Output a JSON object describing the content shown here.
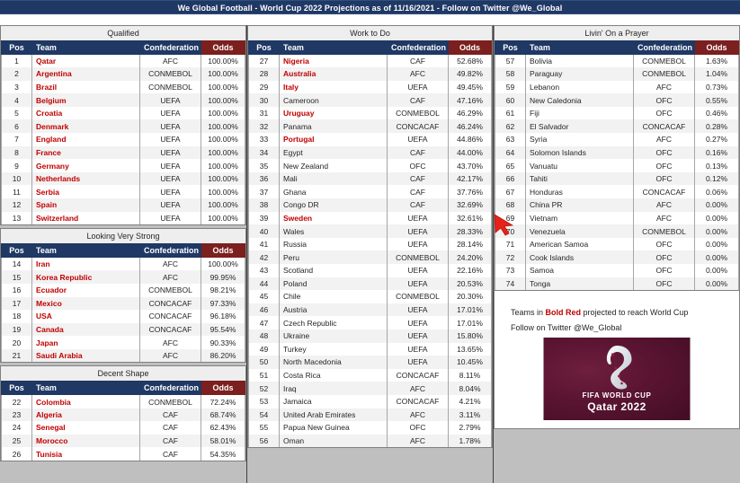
{
  "header": {
    "title": "We Global Football - World Cup 2022 Projections as of 11/16/2021 - Follow on Twitter @We_Global"
  },
  "columns": [
    {
      "band": "Qualified",
      "sections": [
        {
          "band": null,
          "headers": {
            "pos": "Pos",
            "team": "Team",
            "conf": "Confederation",
            "odds": "Odds"
          },
          "rows": [
            {
              "pos": "1",
              "team": "Qatar",
              "conf": "AFC",
              "odds": "100.00%",
              "hot": true
            },
            {
              "pos": "2",
              "team": "Argentina",
              "conf": "CONMEBOL",
              "odds": "100.00%",
              "hot": true
            },
            {
              "pos": "3",
              "team": "Brazil",
              "conf": "CONMEBOL",
              "odds": "100.00%",
              "hot": true
            },
            {
              "pos": "4",
              "team": "Belgium",
              "conf": "UEFA",
              "odds": "100.00%",
              "hot": true
            },
            {
              "pos": "5",
              "team": "Croatia",
              "conf": "UEFA",
              "odds": "100.00%",
              "hot": true
            },
            {
              "pos": "6",
              "team": "Denmark",
              "conf": "UEFA",
              "odds": "100.00%",
              "hot": true
            },
            {
              "pos": "7",
              "team": "England",
              "conf": "UEFA",
              "odds": "100.00%",
              "hot": true
            },
            {
              "pos": "8",
              "team": "France",
              "conf": "UEFA",
              "odds": "100.00%",
              "hot": true
            },
            {
              "pos": "9",
              "team": "Germany",
              "conf": "UEFA",
              "odds": "100.00%",
              "hot": true
            },
            {
              "pos": "10",
              "team": "Netherlands",
              "conf": "UEFA",
              "odds": "100.00%",
              "hot": true
            },
            {
              "pos": "11",
              "team": "Serbia",
              "conf": "UEFA",
              "odds": "100.00%",
              "hot": true
            },
            {
              "pos": "12",
              "team": "Spain",
              "conf": "UEFA",
              "odds": "100.00%",
              "hot": true
            },
            {
              "pos": "13",
              "team": "Switzerland",
              "conf": "UEFA",
              "odds": "100.00%",
              "hot": true
            }
          ]
        },
        {
          "band": "Looking Very Strong",
          "headers": {
            "pos": "Pos",
            "team": "Team",
            "conf": "Confederation",
            "odds": "Odds"
          },
          "rows": [
            {
              "pos": "14",
              "team": "Iran",
              "conf": "AFC",
              "odds": "100.00%",
              "hot": true
            },
            {
              "pos": "15",
              "team": "Korea Republic",
              "conf": "AFC",
              "odds": "99.95%",
              "hot": true
            },
            {
              "pos": "16",
              "team": "Ecuador",
              "conf": "CONMEBOL",
              "odds": "98.21%",
              "hot": true
            },
            {
              "pos": "17",
              "team": "Mexico",
              "conf": "CONCACAF",
              "odds": "97.33%",
              "hot": true
            },
            {
              "pos": "18",
              "team": "USA",
              "conf": "CONCACAF",
              "odds": "96.18%",
              "hot": true
            },
            {
              "pos": "19",
              "team": "Canada",
              "conf": "CONCACAF",
              "odds": "95.54%",
              "hot": true
            },
            {
              "pos": "20",
              "team": "Japan",
              "conf": "AFC",
              "odds": "90.33%",
              "hot": true
            },
            {
              "pos": "21",
              "team": "Saudi Arabia",
              "conf": "AFC",
              "odds": "86.20%",
              "hot": true
            }
          ]
        },
        {
          "band": "Decent Shape",
          "headers": {
            "pos": "Pos",
            "team": "Team",
            "conf": "Confederation",
            "odds": "Odds"
          },
          "rows": [
            {
              "pos": "22",
              "team": "Colombia",
              "conf": "CONMEBOL",
              "odds": "72.24%",
              "hot": true
            },
            {
              "pos": "23",
              "team": "Algeria",
              "conf": "CAF",
              "odds": "68.74%",
              "hot": true
            },
            {
              "pos": "24",
              "team": "Senegal",
              "conf": "CAF",
              "odds": "62.43%",
              "hot": true
            },
            {
              "pos": "25",
              "team": "Morocco",
              "conf": "CAF",
              "odds": "58.01%",
              "hot": true
            },
            {
              "pos": "26",
              "team": "Tunisia",
              "conf": "CAF",
              "odds": "54.35%",
              "hot": true
            }
          ]
        }
      ]
    },
    {
      "band": "Work to Do",
      "sections": [
        {
          "band": null,
          "headers": {
            "pos": "Pos",
            "team": "Team",
            "conf": "Confederation",
            "odds": "Odds"
          },
          "rows": [
            {
              "pos": "27",
              "team": "Nigeria",
              "conf": "CAF",
              "odds": "52.68%",
              "hot": true
            },
            {
              "pos": "28",
              "team": "Australia",
              "conf": "AFC",
              "odds": "49.82%",
              "hot": true
            },
            {
              "pos": "29",
              "team": "Italy",
              "conf": "UEFA",
              "odds": "49.45%",
              "hot": true
            },
            {
              "pos": "30",
              "team": "Cameroon",
              "conf": "CAF",
              "odds": "47.16%",
              "hot": false
            },
            {
              "pos": "31",
              "team": "Uruguay",
              "conf": "CONMEBOL",
              "odds": "46.29%",
              "hot": true
            },
            {
              "pos": "32",
              "team": "Panama",
              "conf": "CONCACAF",
              "odds": "46.24%",
              "hot": false
            },
            {
              "pos": "33",
              "team": "Portugal",
              "conf": "UEFA",
              "odds": "44.86%",
              "hot": true
            },
            {
              "pos": "34",
              "team": "Egypt",
              "conf": "CAF",
              "odds": "44.00%",
              "hot": false
            },
            {
              "pos": "35",
              "team": "New Zealand",
              "conf": "OFC",
              "odds": "43.70%",
              "hot": false
            },
            {
              "pos": "36",
              "team": "Mali",
              "conf": "CAF",
              "odds": "42.17%",
              "hot": false
            },
            {
              "pos": "37",
              "team": "Ghana",
              "conf": "CAF",
              "odds": "37.76%",
              "hot": false
            },
            {
              "pos": "38",
              "team": "Congo DR",
              "conf": "CAF",
              "odds": "32.69%",
              "hot": false
            },
            {
              "pos": "39",
              "team": "Sweden",
              "conf": "UEFA",
              "odds": "32.61%",
              "hot": true
            },
            {
              "pos": "40",
              "team": "Wales",
              "conf": "UEFA",
              "odds": "28.33%",
              "hot": false
            },
            {
              "pos": "41",
              "team": "Russia",
              "conf": "UEFA",
              "odds": "28.14%",
              "hot": false
            },
            {
              "pos": "42",
              "team": "Peru",
              "conf": "CONMEBOL",
              "odds": "24.20%",
              "hot": false
            },
            {
              "pos": "43",
              "team": "Scotland",
              "conf": "UEFA",
              "odds": "22.16%",
              "hot": false
            },
            {
              "pos": "44",
              "team": "Poland",
              "conf": "UEFA",
              "odds": "20.53%",
              "hot": false
            },
            {
              "pos": "45",
              "team": "Chile",
              "conf": "CONMEBOL",
              "odds": "20.30%",
              "hot": false
            },
            {
              "pos": "46",
              "team": "Austria",
              "conf": "UEFA",
              "odds": "17.01%",
              "hot": false
            },
            {
              "pos": "47",
              "team": "Czech Republic",
              "conf": "UEFA",
              "odds": "17.01%",
              "hot": false
            },
            {
              "pos": "48",
              "team": "Ukraine",
              "conf": "UEFA",
              "odds": "15.80%",
              "hot": false
            },
            {
              "pos": "49",
              "team": "Turkey",
              "conf": "UEFA",
              "odds": "13.65%",
              "hot": false
            },
            {
              "pos": "50",
              "team": "North Macedonia",
              "conf": "UEFA",
              "odds": "10.45%",
              "hot": false
            },
            {
              "pos": "51",
              "team": "Costa Rica",
              "conf": "CONCACAF",
              "odds": "8.11%",
              "hot": false
            },
            {
              "pos": "52",
              "team": "Iraq",
              "conf": "AFC",
              "odds": "8.04%",
              "hot": false
            },
            {
              "pos": "53",
              "team": "Jamaica",
              "conf": "CONCACAF",
              "odds": "4.21%",
              "hot": false
            },
            {
              "pos": "54",
              "team": "United Arab Emirates",
              "conf": "AFC",
              "odds": "3.11%",
              "hot": false
            },
            {
              "pos": "55",
              "team": "Papua New Guinea",
              "conf": "OFC",
              "odds": "2.79%",
              "hot": false
            },
            {
              "pos": "56",
              "team": "Oman",
              "conf": "AFC",
              "odds": "1.78%",
              "hot": false
            }
          ]
        }
      ]
    },
    {
      "band": "Livin' On a Prayer",
      "sections": [
        {
          "band": null,
          "headers": {
            "pos": "Pos",
            "team": "Team",
            "conf": "Confederation",
            "odds": "Odds"
          },
          "rows": [
            {
              "pos": "57",
              "team": "Bolivia",
              "conf": "CONMEBOL",
              "odds": "1.63%",
              "hot": false
            },
            {
              "pos": "58",
              "team": "Paraguay",
              "conf": "CONMEBOL",
              "odds": "1.04%",
              "hot": false
            },
            {
              "pos": "59",
              "team": "Lebanon",
              "conf": "AFC",
              "odds": "0.73%",
              "hot": false
            },
            {
              "pos": "60",
              "team": "New Caledonia",
              "conf": "OFC",
              "odds": "0.55%",
              "hot": false
            },
            {
              "pos": "61",
              "team": "Fiji",
              "conf": "OFC",
              "odds": "0.46%",
              "hot": false
            },
            {
              "pos": "62",
              "team": "El Salvador",
              "conf": "CONCACAF",
              "odds": "0.28%",
              "hot": false
            },
            {
              "pos": "63",
              "team": "Syria",
              "conf": "AFC",
              "odds": "0.27%",
              "hot": false
            },
            {
              "pos": "64",
              "team": "Solomon Islands",
              "conf": "OFC",
              "odds": "0.16%",
              "hot": false
            },
            {
              "pos": "65",
              "team": "Vanuatu",
              "conf": "OFC",
              "odds": "0.13%",
              "hot": false
            },
            {
              "pos": "66",
              "team": "Tahiti",
              "conf": "OFC",
              "odds": "0.12%",
              "hot": false
            },
            {
              "pos": "67",
              "team": "Honduras",
              "conf": "CONCACAF",
              "odds": "0.06%",
              "hot": false
            },
            {
              "pos": "68",
              "team": "China PR",
              "conf": "AFC",
              "odds": "0.00%",
              "hot": false
            },
            {
              "pos": "69",
              "team": "Vietnam",
              "conf": "AFC",
              "odds": "0.00%",
              "hot": false
            },
            {
              "pos": "70",
              "team": "Venezuela",
              "conf": "CONMEBOL",
              "odds": "0.00%",
              "hot": false
            },
            {
              "pos": "71",
              "team": "American Samoa",
              "conf": "OFC",
              "odds": "0.00%",
              "hot": false
            },
            {
              "pos": "72",
              "team": "Cook Islands",
              "conf": "OFC",
              "odds": "0.00%",
              "hot": false
            },
            {
              "pos": "73",
              "team": "Samoa",
              "conf": "OFC",
              "odds": "0.00%",
              "hot": false
            },
            {
              "pos": "74",
              "team": "Tonga",
              "conf": "OFC",
              "odds": "0.00%",
              "hot": false
            }
          ]
        }
      ]
    }
  ],
  "footnote": {
    "line1_pre": "Teams in ",
    "line1_highlight": "Bold Red",
    "line1_post": " projected to reach World Cup",
    "line2": "Follow on Twitter @We_Global"
  },
  "logo": {
    "line1": "FIFA WORLD CUP",
    "line2": "Qatar 2022"
  },
  "colors": {
    "header_navy": "#1f3864",
    "odds_maroon": "#7b1f1f",
    "bold_red": "#c00000",
    "band_gray": "#eeeeee",
    "cursor_red": "#e03020"
  }
}
